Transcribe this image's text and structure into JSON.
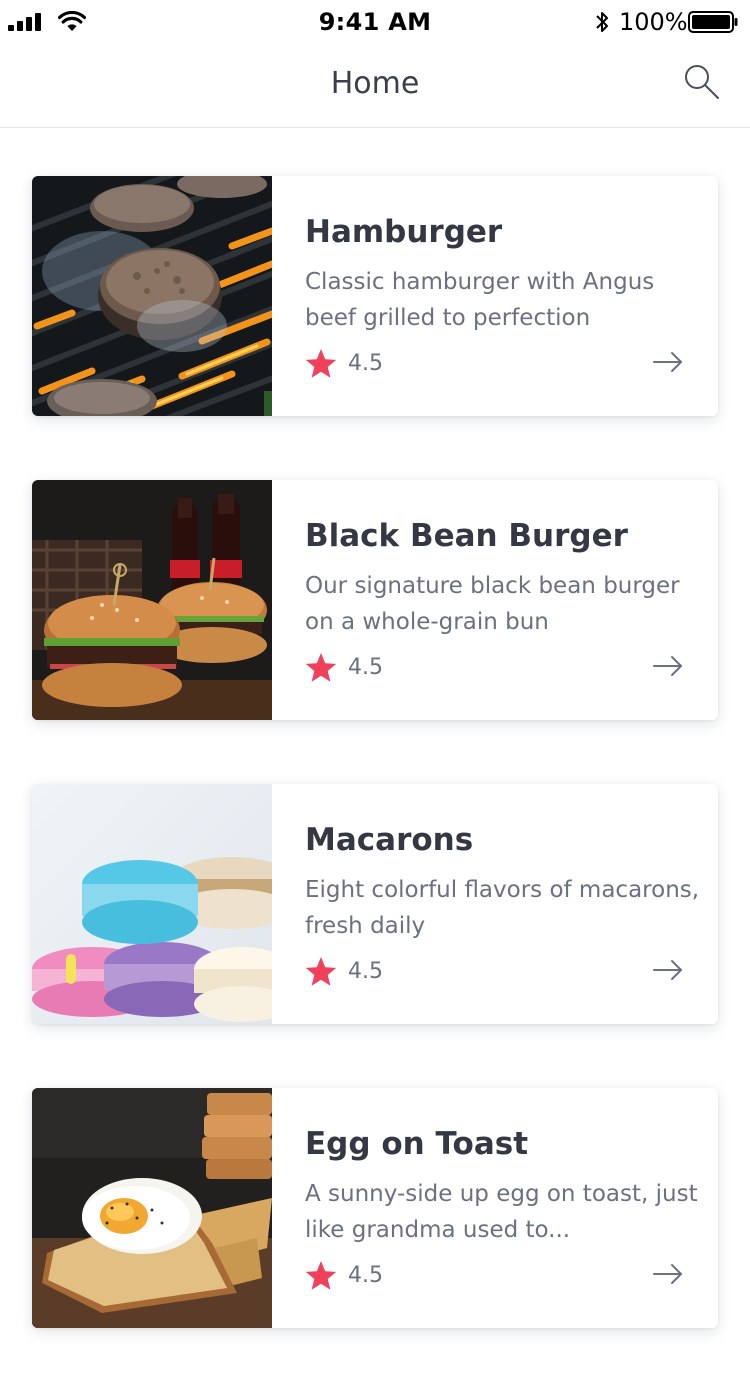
{
  "status_bar": {
    "time": "9:41 AM",
    "battery": "100%"
  },
  "nav": {
    "title": "Home"
  },
  "colors": {
    "star": "#f0405a",
    "text": "#333844",
    "muted": "#6b7180"
  },
  "items": [
    {
      "title": "Hamburger",
      "description": "Classic hamburger with Angus beef grilled to perfection",
      "rating": "4.5"
    },
    {
      "title": "Black Bean Burger",
      "description": "Our signature black bean burger on a whole-grain bun",
      "rating": "4.5"
    },
    {
      "title": "Macarons",
      "description": "Eight colorful flavors of macarons, fresh daily",
      "rating": "4.5"
    },
    {
      "title": "Egg on Toast",
      "description": "A sunny-side up egg on toast, just like grandma used to...",
      "rating": "4.5"
    }
  ]
}
